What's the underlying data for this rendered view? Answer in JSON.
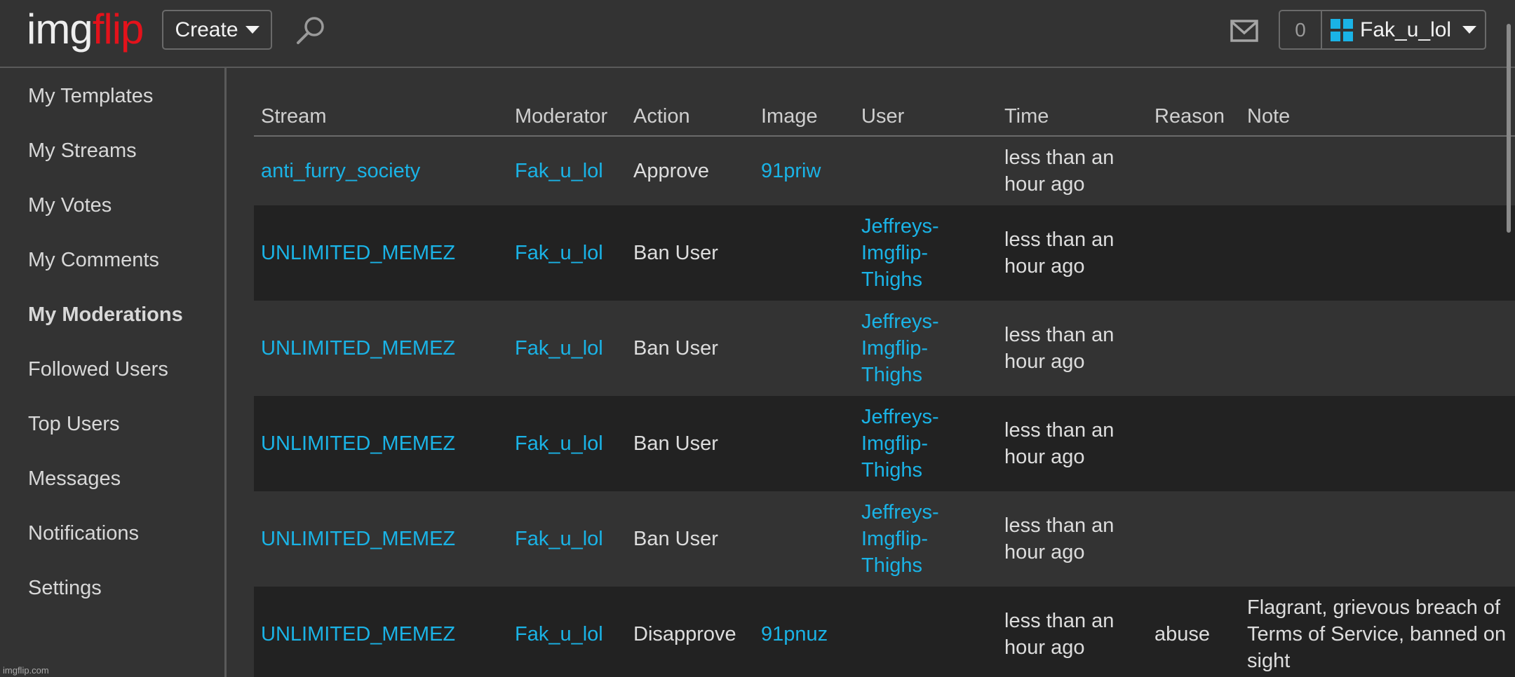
{
  "header": {
    "logo_part1": "img",
    "logo_part2": "flip",
    "create_label": "Create",
    "notification_count": "0",
    "username": "Fak_u_lol"
  },
  "icons": {
    "search": "search-icon",
    "mail": "mail-icon",
    "user_avatar": "grid-icon",
    "dropdown": "chevron-down-icon"
  },
  "colors": {
    "accent": "#1ab3e6",
    "logo_red": "#e4121b",
    "bg": "#333333",
    "row_alt": "#222222"
  },
  "sidebar": {
    "items": [
      {
        "label": "My Templates"
      },
      {
        "label": "My Streams"
      },
      {
        "label": "My Votes"
      },
      {
        "label": "My Comments"
      },
      {
        "label": "My Moderations",
        "active": true
      },
      {
        "label": "Followed Users"
      },
      {
        "label": "Top Users"
      },
      {
        "label": "Messages"
      },
      {
        "label": "Notifications"
      },
      {
        "label": "Settings"
      }
    ]
  },
  "footer": {
    "watermark": "imgflip.com"
  },
  "table": {
    "headers": [
      "Stream",
      "Moderator",
      "Action",
      "Image",
      "User",
      "Time",
      "Reason",
      "Note"
    ],
    "rows": [
      {
        "stream": "anti_furry_society",
        "moderator": "Fak_u_lol",
        "action": "Approve",
        "image": "91priw",
        "user": "",
        "time": "less than an hour ago",
        "reason": "",
        "note": ""
      },
      {
        "stream": "UNLIMITED_MEMEZ",
        "moderator": "Fak_u_lol",
        "action": "Ban User",
        "image": "",
        "user": "Jeffreys-Imgflip-Thighs",
        "time": "less than an hour ago",
        "reason": "",
        "note": ""
      },
      {
        "stream": "UNLIMITED_MEMEZ",
        "moderator": "Fak_u_lol",
        "action": "Ban User",
        "image": "",
        "user": "Jeffreys-Imgflip-Thighs",
        "time": "less than an hour ago",
        "reason": "",
        "note": ""
      },
      {
        "stream": "UNLIMITED_MEMEZ",
        "moderator": "Fak_u_lol",
        "action": "Ban User",
        "image": "",
        "user": "Jeffreys-Imgflip-Thighs",
        "time": "less than an hour ago",
        "reason": "",
        "note": ""
      },
      {
        "stream": "UNLIMITED_MEMEZ",
        "moderator": "Fak_u_lol",
        "action": "Ban User",
        "image": "",
        "user": "Jeffreys-Imgflip-Thighs",
        "time": "less than an hour ago",
        "reason": "",
        "note": ""
      },
      {
        "stream": "UNLIMITED_MEMEZ",
        "moderator": "Fak_u_lol",
        "action": "Disapprove",
        "image": "91pnuz",
        "user": "",
        "time": "less than an hour ago",
        "reason": "abuse",
        "note": "Flagrant, grievous breach of Terms of Service, banned on sight"
      }
    ]
  }
}
